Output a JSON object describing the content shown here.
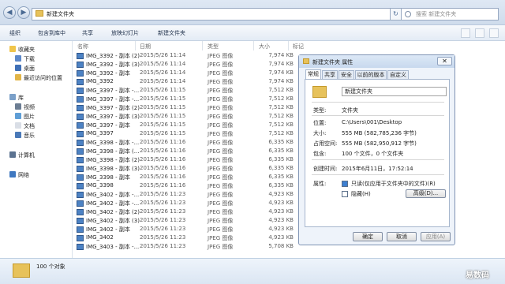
{
  "address": {
    "path": "新建文件夹",
    "search_placeholder": "搜索 新建文件夹"
  },
  "toolbar": {
    "items": [
      "组织",
      "包含到库中",
      "共享",
      "放映幻灯片",
      "新建文件夹"
    ]
  },
  "sidebar": {
    "favorites": "收藏夹",
    "fav_items": [
      "下载",
      "桌面",
      "最近访问的位置"
    ],
    "libraries": "库",
    "lib_items": [
      "视频",
      "图片",
      "文档",
      "音乐"
    ],
    "computer": "计算机",
    "network": "网络"
  },
  "columns": [
    "名称",
    "日期",
    "类型",
    "大小",
    "标记"
  ],
  "files": [
    {
      "name": "IMG_3392 - 副本 (2)",
      "date": "2015/5/26 11:14",
      "type": "JPEG 图像",
      "size": "7,974 KB"
    },
    {
      "name": "IMG_3392 - 副本 (3)",
      "date": "2015/5/26 11:14",
      "type": "JPEG 图像",
      "size": "7,974 KB"
    },
    {
      "name": "IMG_3392 - 副本",
      "date": "2015/5/26 11:14",
      "type": "JPEG 图像",
      "size": "7,974 KB"
    },
    {
      "name": "IMG_3392",
      "date": "2015/5/26 11:14",
      "type": "JPEG 图像",
      "size": "7,974 KB"
    },
    {
      "name": "IMG_3397 - 副本 -...",
      "date": "2015/5/26 11:15",
      "type": "JPEG 图像",
      "size": "7,512 KB"
    },
    {
      "name": "IMG_3397 - 副本 -...",
      "date": "2015/5/26 11:15",
      "type": "JPEG 图像",
      "size": "7,512 KB"
    },
    {
      "name": "IMG_3397 - 副本 (2)",
      "date": "2015/5/26 11:15",
      "type": "JPEG 图像",
      "size": "7,512 KB"
    },
    {
      "name": "IMG_3397 - 副本 (3)",
      "date": "2015/5/26 11:15",
      "type": "JPEG 图像",
      "size": "7,512 KB"
    },
    {
      "name": "IMG_3397 - 副本",
      "date": "2015/5/26 11:15",
      "type": "JPEG 图像",
      "size": "7,512 KB"
    },
    {
      "name": "IMG_3397",
      "date": "2015/5/26 11:15",
      "type": "JPEG 图像",
      "size": "7,512 KB"
    },
    {
      "name": "IMG_3398 - 副本 -...",
      "date": "2015/5/26 11:16",
      "type": "JPEG 图像",
      "size": "6,335 KB"
    },
    {
      "name": "IMG_3398 - 副本 (...",
      "date": "2015/5/26 11:16",
      "type": "JPEG 图像",
      "size": "6,335 KB"
    },
    {
      "name": "IMG_3398 - 副本 (2)",
      "date": "2015/5/26 11:16",
      "type": "JPEG 图像",
      "size": "6,335 KB"
    },
    {
      "name": "IMG_3398 - 副本 (3)",
      "date": "2015/5/26 11:16",
      "type": "JPEG 图像",
      "size": "6,335 KB"
    },
    {
      "name": "IMG_3398 - 副本",
      "date": "2015/5/26 11:16",
      "type": "JPEG 图像",
      "size": "6,335 KB"
    },
    {
      "name": "IMG_3398",
      "date": "2015/5/26 11:16",
      "type": "JPEG 图像",
      "size": "6,335 KB"
    },
    {
      "name": "IMG_3402 - 副本 -...",
      "date": "2015/5/26 11:23",
      "type": "JPEG 图像",
      "size": "4,923 KB"
    },
    {
      "name": "IMG_3402 - 副本 -...",
      "date": "2015/5/26 11:23",
      "type": "JPEG 图像",
      "size": "4,923 KB"
    },
    {
      "name": "IMG_3402 - 副本 (2)",
      "date": "2015/5/26 11:23",
      "type": "JPEG 图像",
      "size": "4,923 KB"
    },
    {
      "name": "IMG_3402 - 副本 (3)",
      "date": "2015/5/26 11:23",
      "type": "JPEG 图像",
      "size": "4,923 KB"
    },
    {
      "name": "IMG_3402 - 副本",
      "date": "2015/5/26 11:23",
      "type": "JPEG 图像",
      "size": "4,923 KB"
    },
    {
      "name": "IMG_3402",
      "date": "2015/5/26 11:23",
      "type": "JPEG 图像",
      "size": "4,923 KB"
    },
    {
      "name": "IMG_3403 - 副本 -...",
      "date": "2015/5/26 11:23",
      "type": "JPEG 图像",
      "size": "5,708 KB"
    }
  ],
  "status": {
    "count": "100 个对象"
  },
  "watermark": "易数码",
  "dialog": {
    "title": "新建文件夹 属性",
    "close": "✕",
    "tabs": [
      "常规",
      "共享",
      "安全",
      "以前的版本",
      "自定义"
    ],
    "name": "新建文件夹",
    "type_label": "类型:",
    "type_value": "文件夹",
    "location_label": "位置:",
    "location_value": "C:\\Users\\001\\Desktop",
    "size_label": "大小:",
    "size_value": "555 MB (582,785,236 字节)",
    "disk_label": "占用空间:",
    "disk_value": "555 MB (582,950,912 字节)",
    "contains_label": "包含:",
    "contains_value": "100 个文件，0 个文件夹",
    "created_label": "创建时间:",
    "created_value": "2015年6月11日，17:52:14",
    "attrs_label": "属性:",
    "readonly": "只读(仅应用于文件夹中的文件)(R)",
    "hidden": "隐藏(H)",
    "advanced": "高级(D)...",
    "ok": "确定",
    "cancel": "取消",
    "apply": "应用(A)"
  }
}
